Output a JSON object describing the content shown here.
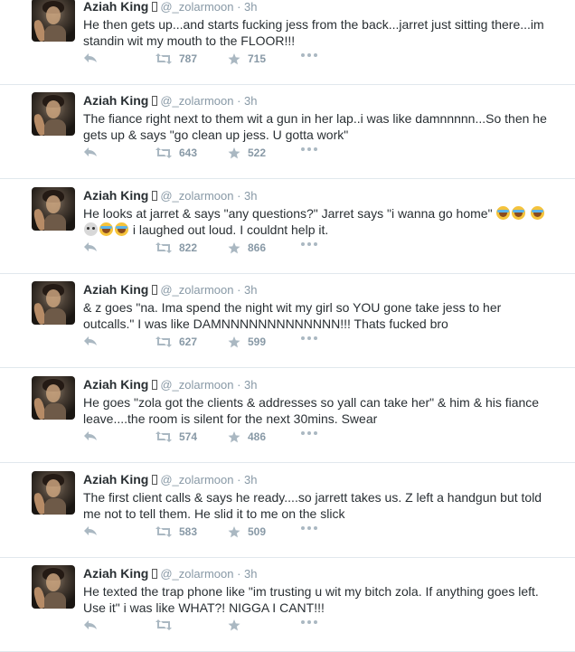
{
  "tweets": [
    {
      "name": "Aziah King",
      "handle": "@_zolarmoon",
      "time": "3h",
      "segments": [
        {
          "t": "He then gets up...and starts fucking jess from the back...jarret just sitting there...im standin wit my mouth to the FLOOR!!!"
        }
      ],
      "retweets": "787",
      "favorites": "715"
    },
    {
      "name": "Aziah King",
      "handle": "@_zolarmoon",
      "time": "3h",
      "segments": [
        {
          "t": "The fiance right next to them wit a gun in her lap..i was like damnnnnn...So then he gets up & says \"go clean up jess. U gotta work\""
        }
      ],
      "retweets": "643",
      "favorites": "522"
    },
    {
      "name": "Aziah King",
      "handle": "@_zolarmoon",
      "time": "3h",
      "segments": [
        {
          "t": "He looks at jarret & says \"any questions?\" Jarret says \"i wanna go home\" "
        },
        {
          "e": "cry"
        },
        {
          "e": "cry"
        },
        {
          "t": " "
        },
        {
          "e": "cry"
        },
        {
          "e": "skull"
        },
        {
          "e": "cry"
        },
        {
          "e": "cry"
        },
        {
          "t": " i laughed out loud. I couldnt help it."
        }
      ],
      "retweets": "822",
      "favorites": "866"
    },
    {
      "name": "Aziah King",
      "handle": "@_zolarmoon",
      "time": "3h",
      "segments": [
        {
          "t": "& z goes \"na. Ima spend the night wit my girl so YOU gone take jess to her outcalls.\" I was like DAMNNNNNNNNNNNNN!!! Thats fucked bro"
        }
      ],
      "retweets": "627",
      "favorites": "599"
    },
    {
      "name": "Aziah King",
      "handle": "@_zolarmoon",
      "time": "3h",
      "segments": [
        {
          "t": "He goes \"zola got the clients & addresses so yall can take her\" & him & his fiance leave....the room is silent for the next 30mins. Swear"
        }
      ],
      "retweets": "574",
      "favorites": "486"
    },
    {
      "name": "Aziah King",
      "handle": "@_zolarmoon",
      "time": "3h",
      "segments": [
        {
          "t": "The first client calls & says he ready....so jarrett takes us. Z left a handgun but told me not to tell them. He slid it to me on the slick"
        }
      ],
      "retweets": "583",
      "favorites": "509"
    },
    {
      "name": "Aziah King",
      "handle": "@_zolarmoon",
      "time": "3h",
      "segments": [
        {
          "t": "He texted the trap phone like \"im trusting u wit my bitch zola. If anything goes left. Use it\" i was like WHAT?! NIGGA I CANT!!!"
        }
      ],
      "retweets": "",
      "favorites": ""
    }
  ],
  "icons": {
    "reply": "reply-icon",
    "retweet": "retweet-icon",
    "favorite": "star-icon",
    "more": "more-dots-icon"
  },
  "colors": {
    "icon": "#aab8c2",
    "text": "#292f33",
    "meta": "#8899a6",
    "divider": "#e1e8ed"
  }
}
